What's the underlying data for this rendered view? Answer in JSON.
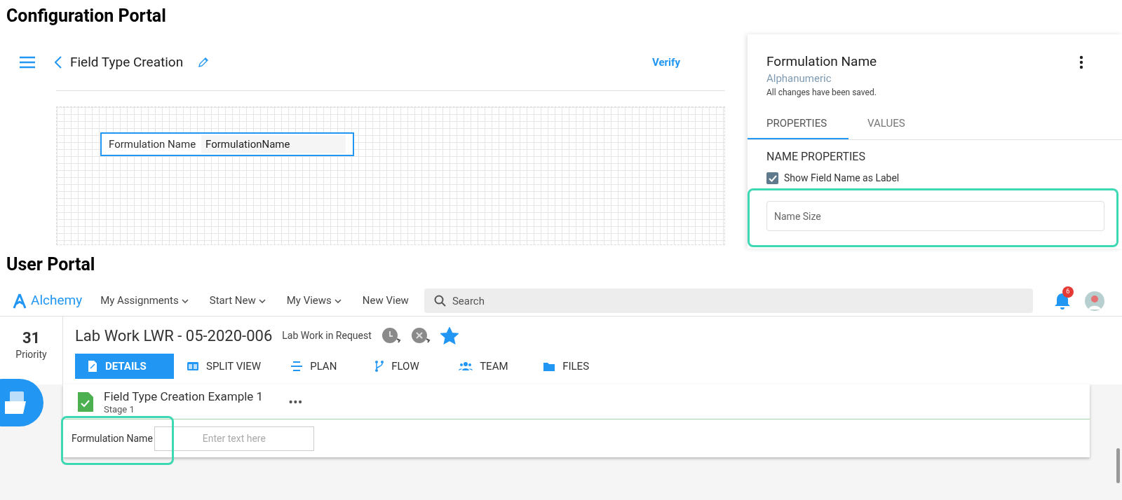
{
  "config_portal": {
    "heading": "Configuration Portal",
    "toolbar": {
      "title": "Field Type Creation",
      "action": "Verify"
    },
    "canvas_field": {
      "label": "Formulation Name",
      "value": "FormulationName"
    },
    "panel": {
      "title": "Formulation Name",
      "type": "Alphanumeric",
      "status": "All changes have been saved.",
      "tabs": [
        {
          "label": "PROPERTIES",
          "selected": true
        },
        {
          "label": "VALUES",
          "selected": false
        }
      ],
      "section": "NAME PROPERTIES",
      "checkbox": {
        "label": "Show Field Name as Label",
        "checked": true
      },
      "name_size": {
        "placeholder": "Name Size"
      }
    }
  },
  "user_portal": {
    "heading": "User Portal",
    "nav": {
      "logo": "Alchemy",
      "menu": [
        {
          "label": "My Assignments",
          "dropdown": true
        },
        {
          "label": "Start New",
          "dropdown": true
        },
        {
          "label": "My Views",
          "dropdown": true
        },
        {
          "label": "New View",
          "dropdown": false
        }
      ],
      "search": {
        "placeholder": "Search"
      },
      "notifications": "6"
    },
    "record": {
      "priority": "31",
      "priority_label": "Priority",
      "title": "Lab Work LWR - 05-2020-006",
      "status": "Lab Work in Request",
      "starred": true,
      "tabs": [
        {
          "label": "DETAILS",
          "kind": "details",
          "selected": true
        },
        {
          "label": "SPLIT VIEW",
          "kind": "split",
          "selected": false
        },
        {
          "label": "PLAN",
          "kind": "plan",
          "selected": false
        },
        {
          "label": "FLOW",
          "kind": "flow",
          "selected": false
        },
        {
          "label": "TEAM",
          "kind": "team",
          "selected": false
        },
        {
          "label": "FILES",
          "kind": "files",
          "selected": false
        }
      ]
    },
    "card": {
      "title": "Field Type Creation Example 1",
      "stage": "Stage 1",
      "more": "•••",
      "field": {
        "label": "Formulation Name",
        "placeholder": "Enter text here"
      }
    }
  }
}
